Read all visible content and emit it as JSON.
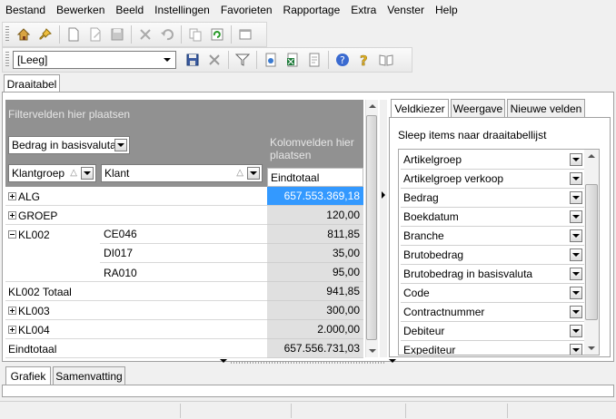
{
  "menu": [
    "Bestand",
    "Bewerken",
    "Beeld",
    "Instellingen",
    "Favorieten",
    "Rapportage",
    "Extra",
    "Venster",
    "Help"
  ],
  "toolbar": {
    "filter_value": "[Leeg]"
  },
  "tabs": {
    "main": "Draaitabel"
  },
  "pivot": {
    "filter_zone_label": "Filtervelden hier plaatsen",
    "data_field": "Bedrag in basisvaluta",
    "column_zone_label": "Kolomvelden hier plaatsen",
    "row_fields": [
      "Klantgroep",
      "Klant"
    ],
    "total_header": "Eindtotaal",
    "rows": [
      {
        "group": "ALG",
        "client": "",
        "value": "657.553.369,18",
        "expander": "plus"
      },
      {
        "group": "GROEP",
        "client": "",
        "value": "120,00",
        "expander": "plus"
      },
      {
        "group": "KL002",
        "client": "CE046",
        "value": "811,85",
        "expander": "minus"
      },
      {
        "group": "",
        "client": "DI017",
        "value": "35,00",
        "expander": ""
      },
      {
        "group": "",
        "client": "RA010",
        "value": "95,00",
        "expander": ""
      },
      {
        "group": "KL002 Totaal",
        "client": "",
        "value": "941,85",
        "expander": ""
      },
      {
        "group": "KL003",
        "client": "",
        "value": "300,00",
        "expander": "plus"
      },
      {
        "group": "KL004",
        "client": "",
        "value": "2.000,00",
        "expander": "plus"
      },
      {
        "group": "Eindtotaal",
        "client": "",
        "value": "657.556.731,03",
        "expander": ""
      }
    ]
  },
  "right_panel": {
    "tabs": [
      "Veldkiezer",
      "Weergave",
      "Nieuwe velden"
    ],
    "title": "Sleep items naar draaitabellijst",
    "fields": [
      "Artikelgroep",
      "Artikelgroep verkoop",
      "Bedrag",
      "Boekdatum",
      "Branche",
      "Brutobedrag",
      "Brutobedrag in basisvaluta",
      "Code",
      "Contractnummer",
      "Debiteur",
      "Expediteur"
    ]
  },
  "bottom_tabs": [
    "Grafiek",
    "Samenvatting"
  ],
  "colors": {
    "zone_gray": "#919191",
    "selected": "#3399ff",
    "value_bg": "#e0e0e0"
  }
}
